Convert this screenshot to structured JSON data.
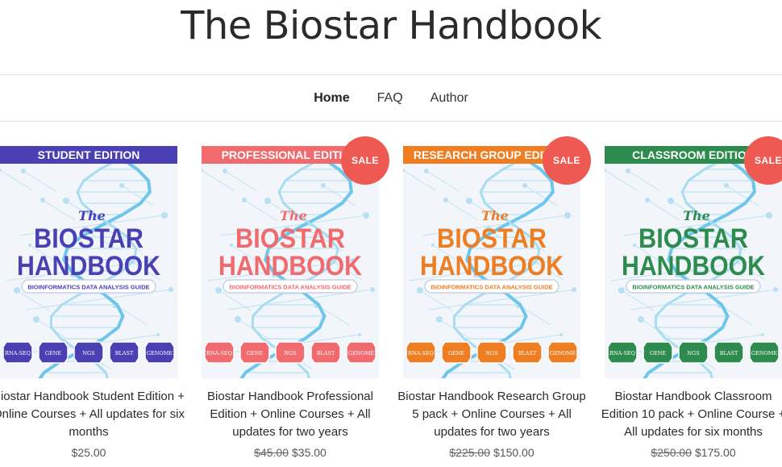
{
  "site": {
    "title": "The Biostar Handbook"
  },
  "nav": {
    "items": [
      "Home",
      "FAQ",
      "Author"
    ]
  },
  "products": [
    {
      "edition": "STUDENT EDITION",
      "cover_the": "The",
      "cover_line1": "BIOSTAR",
      "cover_line2": "HANDBOOK",
      "cover_sub": "BIOINFORMATICS DATA ANALYSIS GUIDE",
      "badges": [
        "RNA-SEQ",
        "GENE",
        "NGS",
        "BLAST",
        "GENOME"
      ],
      "color": "#4a3fb3",
      "sale": "",
      "title": "Biostar Handbook Student Edition + Online Courses + All updates for six months",
      "price_old": "",
      "price": "$25.00"
    },
    {
      "edition": "PROFESSIONAL EDITION",
      "cover_the": "The",
      "cover_line1": "BIOSTAR",
      "cover_line2": "HANDBOOK",
      "cover_sub": "BIOINFORMATICS DATA ANALYSIS GUIDE",
      "badges": [
        "RNA-SEQ",
        "GENE",
        "NGS",
        "BLAST",
        "GENOME"
      ],
      "color": "#f06a6e",
      "sale": "SALE",
      "title": "Biostar Handbook Professional Edition + Online Courses + All updates for two years",
      "price_old": "$45.00",
      "price": "$35.00"
    },
    {
      "edition": "RESEARCH GROUP EDITION",
      "cover_the": "The",
      "cover_line1": "BIOSTAR",
      "cover_line2": "HANDBOOK",
      "cover_sub": "BIOINFORMATICS DATA ANALYSIS GUIDE",
      "badges": [
        "RNA-SEQ",
        "GENE",
        "NGS",
        "BLAST",
        "GENOME"
      ],
      "color": "#ef7d22",
      "sale": "SALE",
      "title": "Biostar Handbook Research Group 5 pack + Online Courses + All updates for two years",
      "price_old": "$225.00",
      "price": "$150.00"
    },
    {
      "edition": "CLASSROOM EDITION",
      "cover_the": "The",
      "cover_line1": "BIOSTAR",
      "cover_line2": "HANDBOOK",
      "cover_sub": "BIOINFORMATICS DATA ANALYSIS GUIDE",
      "badges": [
        "RNA-SEQ",
        "GENE",
        "NGS",
        "BLAST",
        "GENOME"
      ],
      "color": "#2e8b4e",
      "sale": "SALE",
      "title": "Biostar Handbook Classroom Edition 10 pack + Online Course + All updates for six months",
      "price_old": "$250.00",
      "price": "$175.00"
    }
  ]
}
